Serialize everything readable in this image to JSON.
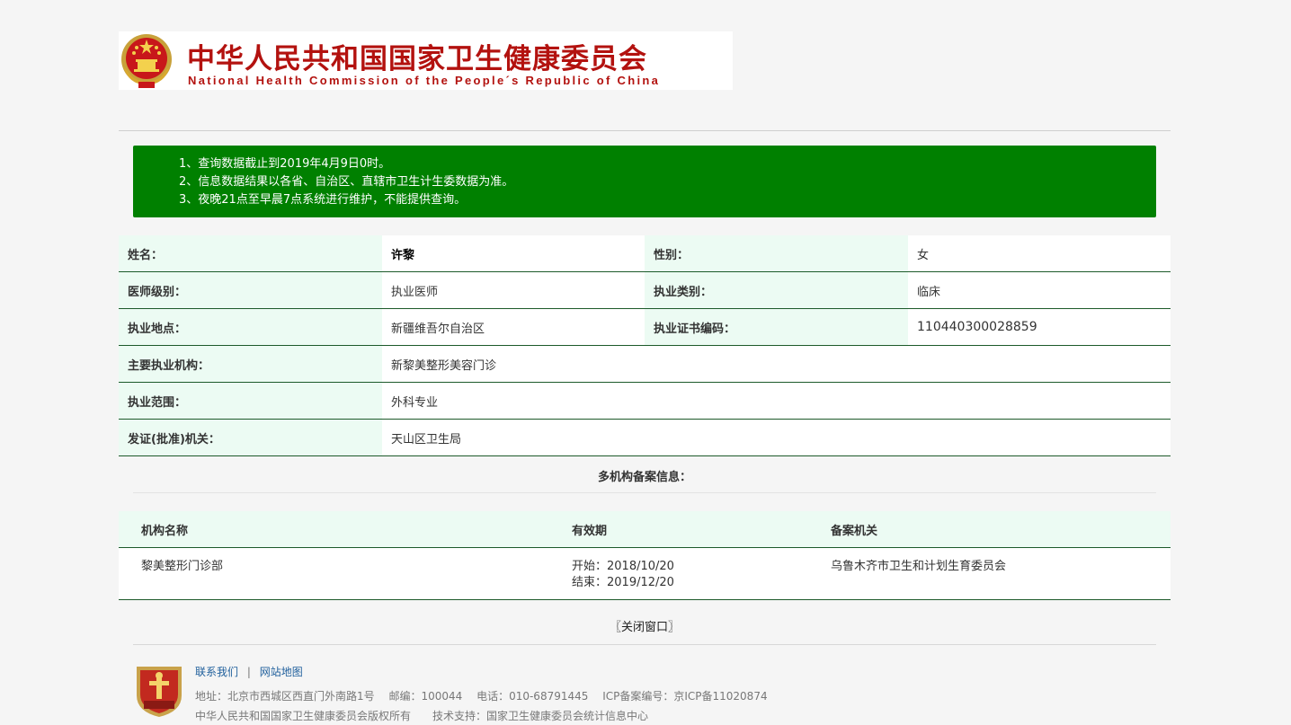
{
  "header": {
    "org_name_cn": "中华人民共和国国家卫生健康委员会",
    "org_name_en": "National Health Commission of the People´s Republic of China",
    "brand_red": "#b3120f",
    "emblem_icon": "national-emblem-icon"
  },
  "notice": {
    "background": "#008000",
    "lines": [
      "1、查询数据截止到2019年4月9日0时。",
      "2、信息数据结果以各省、自治区、直辖市卫生计生委数据为准。",
      "3、夜晚21点至早晨7点系统进行维护，不能提供查询。"
    ]
  },
  "record": {
    "name_label": "姓名：",
    "name_value": "许黎",
    "gender_label": "性别：",
    "gender_value": "女",
    "level_label": "医师级别：",
    "level_value": "执业医师",
    "category_label": "执业类别：",
    "category_value": "临床",
    "location_label": "执业地点：",
    "location_value": "新疆维吾尔自治区",
    "cert_label": "执业证书编码：",
    "cert_value": "110440300028859",
    "institution_label": "主要执业机构：",
    "institution_value": "新黎美整形美容门诊",
    "scope_label": "执业范围：",
    "scope_value": "外科专业",
    "issuer_label": "发证(批准)机关：",
    "issuer_value": "天山区卫生局"
  },
  "multi_filing": {
    "title": "多机构备案信息：",
    "headers": [
      "机构名称",
      "有效期",
      "备案机关"
    ],
    "rows": [
      {
        "name": "黎美整形门诊部",
        "start": "开始：2018/10/20",
        "end": "结束：2019/12/20",
        "authority": "乌鲁木齐市卫生和计划生育委员会"
      }
    ]
  },
  "close_label": "〖关闭窗口〗",
  "footer": {
    "badge_icon": "party-government-badge-icon",
    "contact_label": "联系我们",
    "separator": "|",
    "sitemap_label": "网站地图",
    "address_line": "地址：北京市西城区西直门外南路1号　 邮编：100044　 电话：010-68791445　 ICP备案编号：京ICP备11020874",
    "copyright_line": "中华人民共和国国家卫生健康委员会版权所有　　技术支持：国家卫生健康委员会统计信息中心"
  }
}
